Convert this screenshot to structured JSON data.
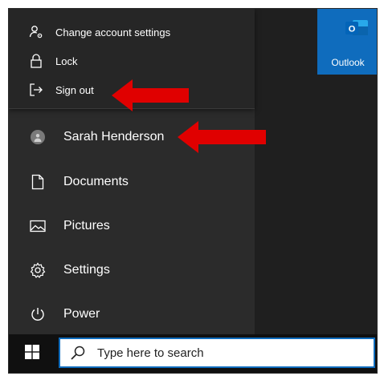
{
  "flyout": {
    "items": [
      {
        "label": "Change account settings",
        "icon": "account-settings-icon"
      },
      {
        "label": "Lock",
        "icon": "lock-icon"
      },
      {
        "label": "Sign out",
        "icon": "sign-out-icon"
      }
    ]
  },
  "menu": {
    "user": {
      "label": "Sarah Henderson",
      "icon": "avatar-icon"
    },
    "items": [
      {
        "label": "Documents",
        "icon": "document-icon"
      },
      {
        "label": "Pictures",
        "icon": "pictures-icon"
      },
      {
        "label": "Settings",
        "icon": "gear-icon"
      },
      {
        "label": "Power",
        "icon": "power-icon"
      }
    ]
  },
  "tile": {
    "label": "Outlook",
    "icon": "outlook-icon",
    "color": "#0f6cbd"
  },
  "taskbar": {
    "start_icon": "windows-logo-icon",
    "search": {
      "placeholder": "Type here to search",
      "icon": "search-icon"
    }
  },
  "annotations": {
    "arrow_color": "#e00000"
  }
}
